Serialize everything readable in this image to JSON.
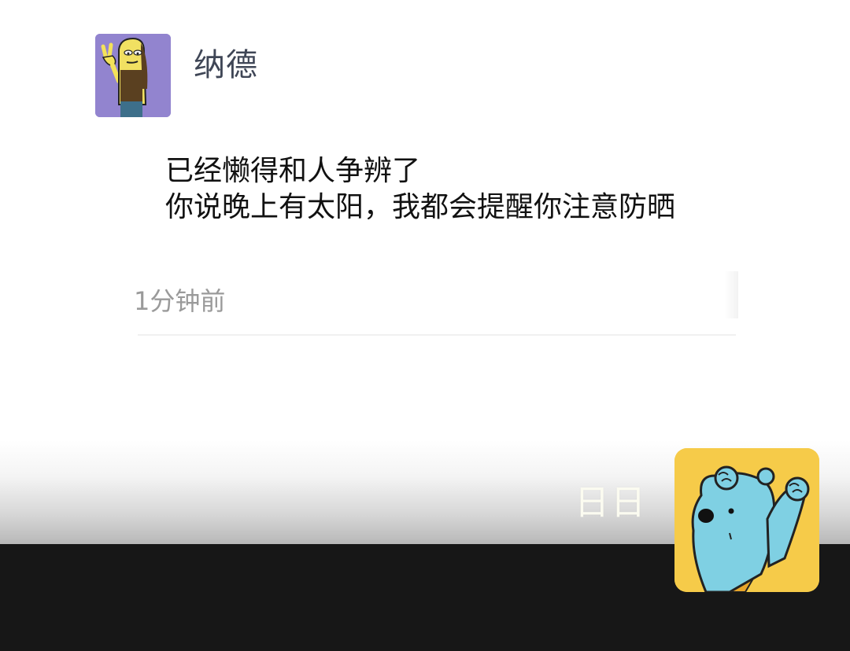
{
  "post": {
    "author": "纳德",
    "content_lines": [
      "已经懒得和人争辨了",
      "你说晚上有太阳，我都会提醒你注意防晒"
    ],
    "timestamp": "1分钟前"
  },
  "overlay": {
    "nickname": "日日"
  },
  "avatars": {
    "top": "cartoon-character-peace-sign",
    "bottom": "blue-bear-raising-fist"
  },
  "colors": {
    "top_avatar_bg": "#9284cf",
    "bottom_avatar_bg": "#f6cb49",
    "bottom_bar": "#171717"
  }
}
